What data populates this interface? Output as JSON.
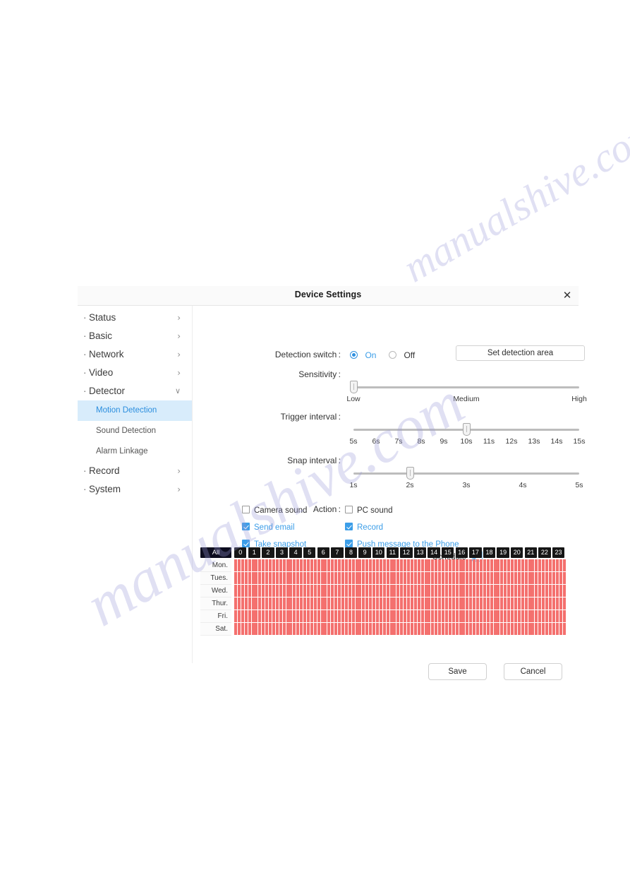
{
  "watermark": {
    "line1": "manualshive.com",
    "line2": "manualshive.com"
  },
  "dialog": {
    "title": "Device Settings",
    "close_icon": "close-icon"
  },
  "sidebar": {
    "items": [
      {
        "label": "Status",
        "chevron": "›",
        "expanded": false
      },
      {
        "label": "Basic",
        "chevron": "›",
        "expanded": false
      },
      {
        "label": "Network",
        "chevron": "›",
        "expanded": false
      },
      {
        "label": "Video",
        "chevron": "›",
        "expanded": false
      },
      {
        "label": "Detector",
        "chevron": "∨",
        "expanded": true
      },
      {
        "label": "Record",
        "chevron": "›",
        "expanded": false
      },
      {
        "label": "System",
        "chevron": "›",
        "expanded": false
      }
    ],
    "bullet": "·",
    "sub_items": [
      {
        "label": "Motion Detection",
        "active": true
      },
      {
        "label": "Sound Detection",
        "active": false
      },
      {
        "label": "Alarm Linkage",
        "active": false
      }
    ]
  },
  "form": {
    "detection_switch": {
      "label": "Detection switch :",
      "on_label": "On",
      "off_label": "Off",
      "selected": "On"
    },
    "set_detection_area_button": "Set detection area",
    "sensitivity": {
      "label": "Sensitivity :",
      "ticks": [
        "Low",
        "Medium",
        "High"
      ],
      "value": "Low",
      "handle_pct": 0
    },
    "trigger_interval": {
      "label": "Trigger interval :",
      "ticks": [
        "5s",
        "6s",
        "7s",
        "8s",
        "9s",
        "10s",
        "11s",
        "12s",
        "13s",
        "14s",
        "15s"
      ],
      "value": "10s",
      "handle_pct": 50
    },
    "snap_interval": {
      "label": "Snap interval :",
      "ticks": [
        "1s",
        "2s",
        "3s",
        "4s",
        "5s"
      ],
      "value": "2s",
      "handle_pct": 25
    },
    "action": {
      "label": "Action :",
      "options": [
        {
          "label": "Camera sound",
          "checked": false,
          "col": 0,
          "row": 0
        },
        {
          "label": "PC sound",
          "checked": false,
          "col": 1,
          "row": 0
        },
        {
          "label": "Send email",
          "checked": true,
          "col": 0,
          "row": 1
        },
        {
          "label": "Record",
          "checked": true,
          "col": 1,
          "row": 1
        },
        {
          "label": "Take snapshot",
          "checked": true,
          "col": 0,
          "row": 2
        },
        {
          "label": "Push message to the Phone",
          "checked": true,
          "col": 1,
          "row": 2
        }
      ]
    },
    "schedule_label": "Schedule",
    "schedule_expand_icon": "expand-arrows-icon"
  },
  "schedule": {
    "all_label": "All",
    "hours": [
      "0",
      "1",
      "2",
      "3",
      "4",
      "5",
      "6",
      "7",
      "8",
      "9",
      "10",
      "11",
      "12",
      "13",
      "14",
      "15",
      "16",
      "17",
      "18",
      "19",
      "20",
      "21",
      "22",
      "23"
    ],
    "days": [
      "Mon.",
      "Tues.",
      "Wed.",
      "Thur.",
      "Fri.",
      "Sat."
    ],
    "selected_color": "#f4706e",
    "all_selected": true
  },
  "footer": {
    "save_label": "Save",
    "cancel_label": "Cancel"
  },
  "colors": {
    "accent": "#3c9ee8",
    "schedule_fill": "#f4706e",
    "active_nav_bg": "#d8ecfb",
    "header_bg": "#fafafa"
  }
}
